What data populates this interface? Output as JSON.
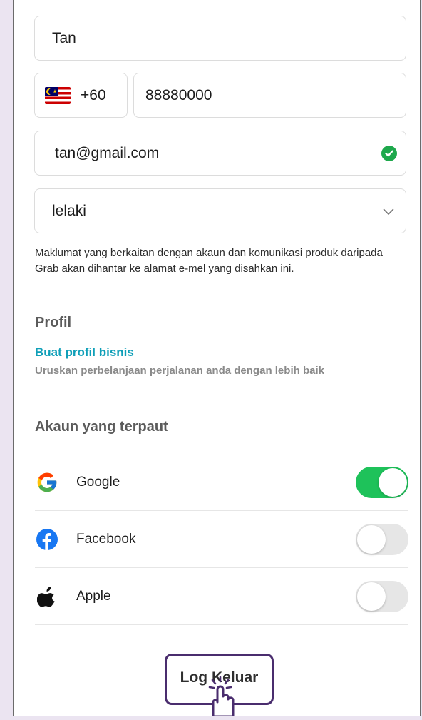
{
  "form": {
    "name_value": "Tan",
    "phone_country_code": "+60",
    "phone_flag_icon": "malaysia-flag-icon",
    "phone_number": "88880000",
    "email_value": "tan@gmail.com",
    "email_verified_icon": "check-circle-icon",
    "gender_value": "lelaki",
    "gender_dropdown_icon": "chevron-down-icon",
    "email_note": "Maklumat yang berkaitan dengan akaun dan komunikasi produk daripada Grab akan dihantar ke alamat e-mel yang disahkan ini."
  },
  "profile": {
    "heading": "Profil",
    "business_link": "Buat profil bisnis",
    "business_subtitle": "Uruskan perbelanjaan perjalanan anda dengan lebih baik"
  },
  "linked_accounts": {
    "heading": "Akaun yang terpaut",
    "items": [
      {
        "label": "Google",
        "icon": "google-icon",
        "enabled": true
      },
      {
        "label": "Facebook",
        "icon": "facebook-icon",
        "enabled": false
      },
      {
        "label": "Apple",
        "icon": "apple-icon",
        "enabled": false
      }
    ]
  },
  "logout": {
    "label": "Log Keluar",
    "pointer_icon": "hand-pointer-icon"
  },
  "colors": {
    "link": "#0f9fb8",
    "toggle_on": "#1ec25a",
    "verified": "#1ea84c",
    "highlight_border": "#4a2d6e",
    "backdrop": "#ebe4f1"
  }
}
